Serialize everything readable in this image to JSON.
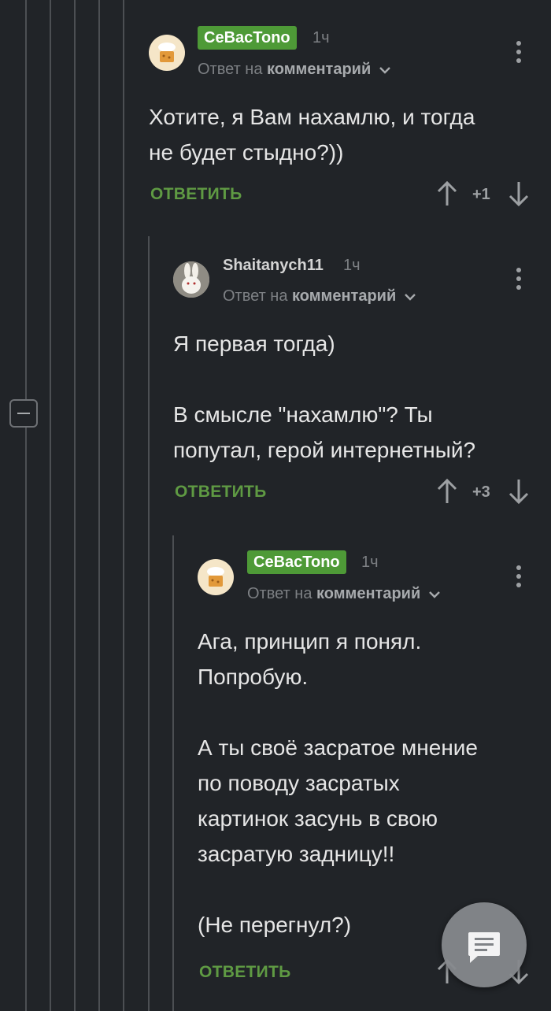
{
  "comments": [
    {
      "author": "CeBacTono",
      "time": "1ч",
      "reply_prefix": "Ответ на",
      "reply_target": "комментарий",
      "text": "Хотите, я Вам нахамлю, и тогда\nне будет стыдно?))",
      "reply_label": "ОТВЕТИТЬ",
      "score": "+1"
    },
    {
      "author": "Shaitanych11",
      "time": "1ч",
      "reply_prefix": "Ответ на",
      "reply_target": "комментарий",
      "text": "Я первая тогда)\n\nВ смысле \"нахамлю\"? Ты\nпопутал, герой интернетный?",
      "reply_label": "ОТВЕТИТЬ",
      "score": "+3"
    },
    {
      "author": "CeBacTono",
      "time": "1ч",
      "reply_prefix": "Ответ на",
      "reply_target": "комментарий",
      "text": "Ага, принцип я понял.\nПопробую.\n\nА ты своё засратое мнение\nпо поводу засратых\nкартинок засунь в свою\nзасратую задницу!!\n\n(Не перегнул?)",
      "reply_label": "ОТВЕТИТЬ"
    }
  ],
  "colors": {
    "background": "#212428",
    "badge": "#4e9a37",
    "reply": "#5f9a43",
    "fab": "#86898d"
  },
  "icons": {
    "collapse": "minus-square-icon",
    "menu": "more-vertical-icon",
    "vote_up": "arrow-up-icon",
    "vote_down": "arrow-down-icon",
    "fab": "comment-icon"
  }
}
